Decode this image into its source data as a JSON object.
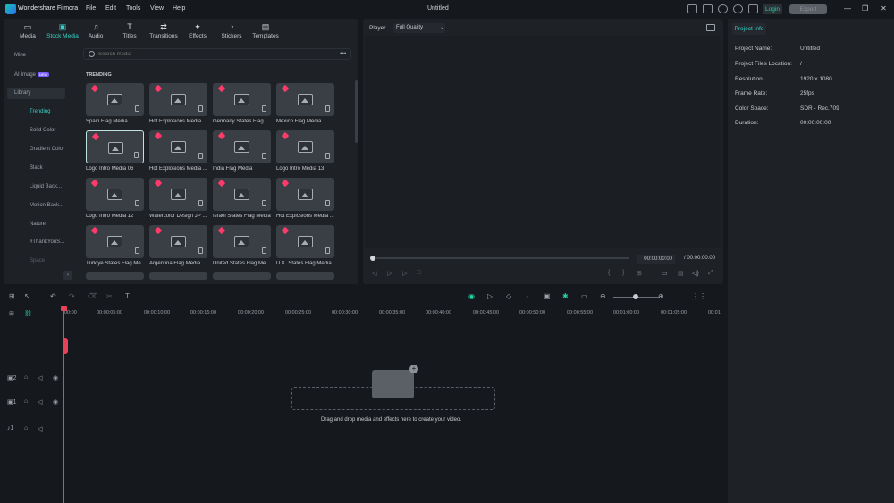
{
  "app": {
    "name": "Wondershare Filmora",
    "title": "Untitled",
    "login": "Login",
    "export": "Export"
  },
  "menu": [
    "File",
    "Edit",
    "Tools",
    "View",
    "Help"
  ],
  "window_controls": [
    "—",
    "❐",
    "✕"
  ],
  "tool_tabs": [
    {
      "label": "Media",
      "icon": "media-icon"
    },
    {
      "label": "Stock Media",
      "icon": "stock-media-icon"
    },
    {
      "label": "Audio",
      "icon": "audio-icon"
    },
    {
      "label": "Titles",
      "icon": "titles-icon"
    },
    {
      "label": "Transitions",
      "icon": "transitions-icon"
    },
    {
      "label": "Effects",
      "icon": "effects-icon"
    },
    {
      "label": "Stickers",
      "icon": "stickers-icon"
    },
    {
      "label": "Templates",
      "icon": "templates-icon"
    }
  ],
  "sidebar": {
    "mine": "Mine",
    "ai_image": "AI Image",
    "ai_badge": "NEW",
    "library": "Library",
    "sub": [
      "Trending",
      "Solid Color",
      "Gradient Color",
      "Black",
      "Liquid Back...",
      "Motion Back...",
      "Nature",
      "#ThankYouS...",
      "Space"
    ]
  },
  "search": {
    "placeholder": "Search media"
  },
  "section": "TRENDING",
  "tiles": [
    "Spain Flag Media",
    "Hot Explosions Media ...",
    "Germany States Flag ...",
    "Mexico Flag Media",
    "Logo Intro Media 06",
    "Hot Explosions Media ...",
    "India Flag Media",
    "Logo Intro Media 13",
    "Logo Intro Media 12",
    "Watercolor Design JP ...",
    "Israel States Flag Media",
    "Hot Explosions Media ...",
    "Türkiye States Flag Me...",
    "Argentina Flag Media",
    "United States Flag Me...",
    "U.K. States Flag Media"
  ],
  "player": {
    "label": "Player",
    "quality": "Full Quality",
    "time_current": "00:00:00:00",
    "time_total": "/ 00:00:00:00"
  },
  "project_info": {
    "tab": "Project Info",
    "rows": [
      {
        "key": "Project Name:",
        "value": "Untitled"
      },
      {
        "key": "Project Files Location:",
        "value": "/"
      },
      {
        "key": "Resolution:",
        "value": "1920 x 1080"
      },
      {
        "key": "Frame Rate:",
        "value": "25fps"
      },
      {
        "key": "Color Space:",
        "value": "SDR - Rec.709"
      },
      {
        "key": "Duration:",
        "value": "00:00:00:00"
      }
    ]
  },
  "timeline": {
    "ticks": [
      "00:00",
      "00:00:05:00",
      "00:00:10:00",
      "00:00:15:00",
      "00:00:20:00",
      "00:00:25:00",
      "00:00:30:00",
      "00:00:35:00",
      "00:00:40:00",
      "00:00:45:00",
      "00:00:50:00",
      "00:00:55:00",
      "00:01:00:00",
      "00:01:05:00",
      "00:01:"
    ],
    "drop_text": "Drag and drop media and effects here to create your video."
  }
}
